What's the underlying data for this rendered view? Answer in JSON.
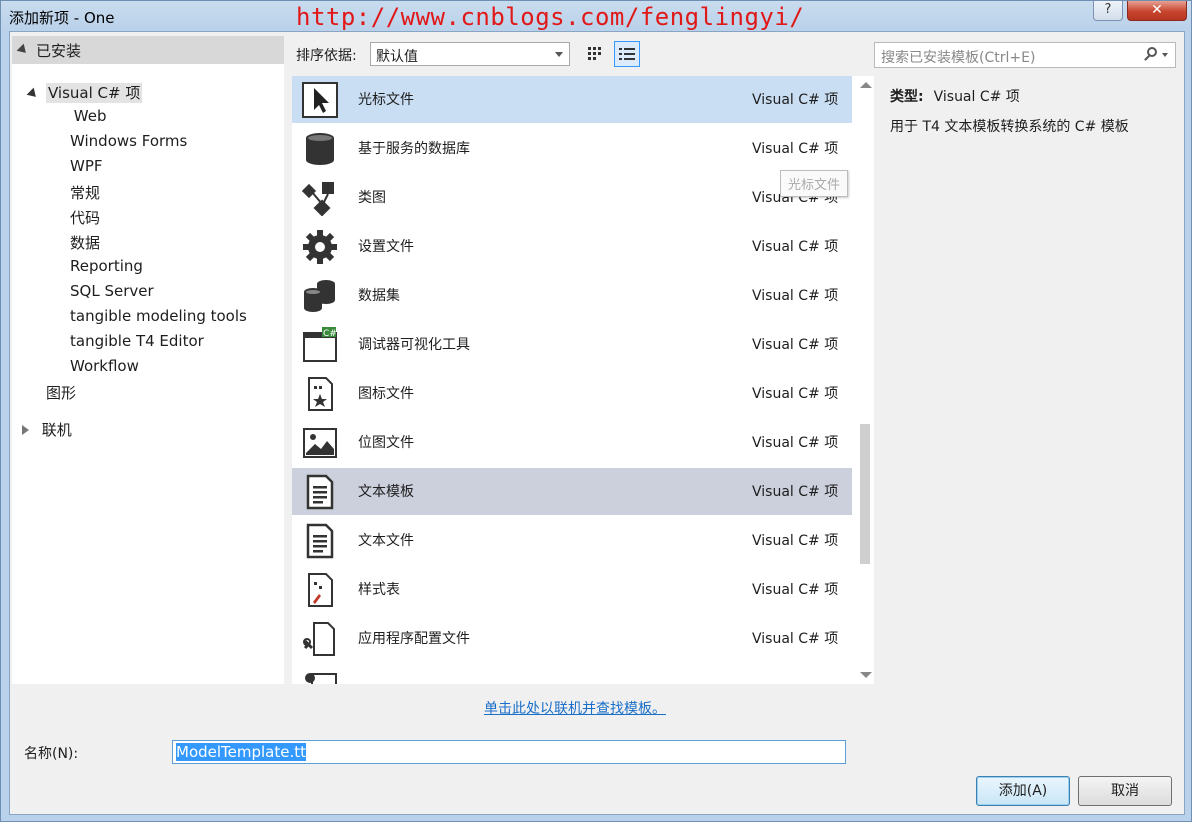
{
  "window": {
    "title": "添加新项 - One",
    "watermark": "http://www.cnblogs.com/fenglingyi/",
    "help_label": "?",
    "close_label": "✕"
  },
  "tree": {
    "installed_label": "已安装",
    "root_label": "Visual C# 项",
    "web_label": "Web",
    "children": [
      "Windows Forms",
      "WPF",
      "常规",
      "代码",
      "数据",
      "Reporting",
      "SQL Server",
      "tangible modeling tools",
      "tangible T4 Editor",
      "Workflow"
    ],
    "graphics_label": "图形",
    "online_label": "联机"
  },
  "sort": {
    "label": "排序依据:",
    "selected": "默认值"
  },
  "templates": [
    {
      "name": "光标文件",
      "type": "Visual C# 项",
      "icon": "cursor-icon"
    },
    {
      "name": "基于服务的数据库",
      "type": "Visual C# 项",
      "icon": "database-icon"
    },
    {
      "name": "类图",
      "type": "Visual C# 项",
      "icon": "class-diagram-icon"
    },
    {
      "name": "设置文件",
      "type": "Visual C# 项",
      "icon": "gear-icon"
    },
    {
      "name": "数据集",
      "type": "Visual C# 项",
      "icon": "dataset-icon"
    },
    {
      "name": "调试器可视化工具",
      "type": "Visual C# 项",
      "icon": "debugger-visualizer-icon"
    },
    {
      "name": "图标文件",
      "type": "Visual C# 项",
      "icon": "icon-file-icon"
    },
    {
      "name": "位图文件",
      "type": "Visual C# 项",
      "icon": "bitmap-icon"
    },
    {
      "name": "文本模板",
      "type": "Visual C# 项",
      "icon": "text-template-icon"
    },
    {
      "name": "文本文件",
      "type": "Visual C# 项",
      "icon": "text-file-icon"
    },
    {
      "name": "样式表",
      "type": "Visual C# 项",
      "icon": "stylesheet-icon"
    },
    {
      "name": "应用程序配置文件",
      "type": "Visual C# 项",
      "icon": "app-config-icon"
    }
  ],
  "tooltip": "光标文件",
  "search": {
    "placeholder": "搜索已安装模板(Ctrl+E)"
  },
  "details": {
    "type_label": "类型:",
    "type_value": "Visual C# 项",
    "description": "用于 T4 文本模板转换系统的 C# 模板"
  },
  "online_link": "单击此处以联机并查找模板。",
  "name_field": {
    "label": "名称(N):",
    "value": "ModelTemplate.tt"
  },
  "buttons": {
    "add": "添加(A)",
    "cancel": "取消"
  }
}
